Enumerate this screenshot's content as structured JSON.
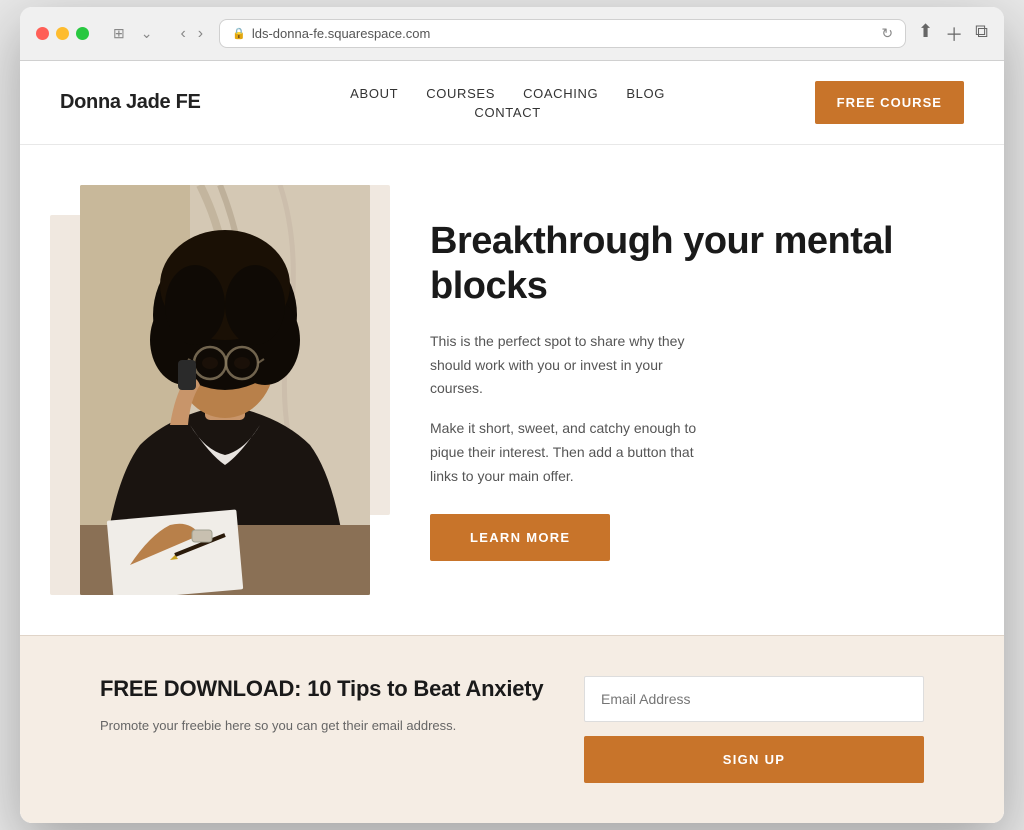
{
  "browser": {
    "url": "lds-donna-fe.squarespace.com",
    "reload_icon": "↻"
  },
  "header": {
    "logo": "Donna Jade FE",
    "nav": {
      "about": "ABOUT",
      "courses": "COURSES",
      "coaching": "COACHING",
      "blog": "BLOG",
      "contact": "CONTACT"
    },
    "cta_button": "FREE COURSE"
  },
  "hero": {
    "title": "Breakthrough your mental blocks",
    "paragraph1": "This is the perfect spot to share why they should work with you or invest in your courses.",
    "paragraph2": "Make it short, sweet, and catchy enough to pique their interest. Then add a button that links to your main offer.",
    "cta_button": "LEARN MORE"
  },
  "download": {
    "title": "FREE DOWNLOAD: 10 Tips to Beat Anxiety",
    "description": "Promote your freebie here so you can get their email address.",
    "email_placeholder": "Email Address",
    "signup_button": "SIGN UP"
  },
  "colors": {
    "accent": "#c8742a",
    "bg_light": "#f5ede4",
    "photo_bg": "#f0e8e0"
  }
}
